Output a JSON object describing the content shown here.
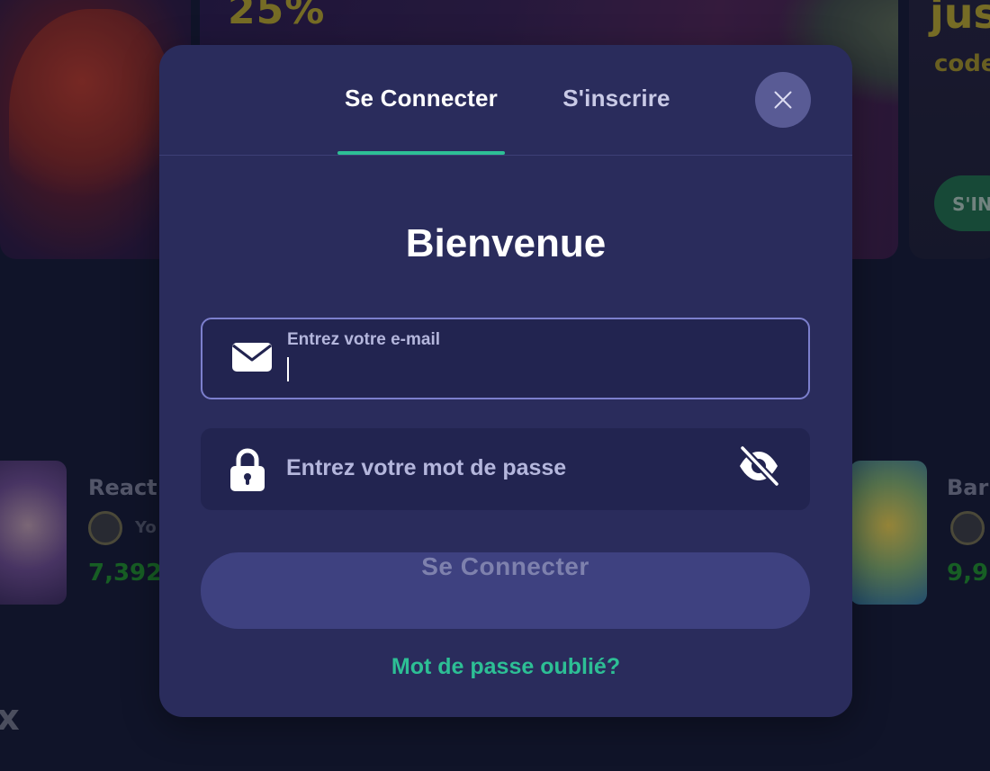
{
  "background": {
    "promo_percent": "25%",
    "promo_right_title": "jus",
    "promo_right_code": "code",
    "promo_right_cta": "S'IN",
    "games": [
      {
        "title": "React",
        "provider": "Yo",
        "amount": "7,392"
      },
      {
        "title": "Bar",
        "provider": "",
        "amount": "9,9"
      }
    ],
    "bottom_glyph": "x"
  },
  "modal": {
    "tabs": [
      {
        "label": "Se Connecter",
        "active": true
      },
      {
        "label": "S'inscrire",
        "active": false
      }
    ],
    "close_icon": "close-icon",
    "title": "Bienvenue",
    "email": {
      "label": "Entrez votre e-mail",
      "value": "",
      "icon": "envelope-icon"
    },
    "password": {
      "placeholder": "Entrez votre mot de passe",
      "value": "",
      "icon": "lock-icon",
      "visibility_icon": "eye-slash-icon"
    },
    "submit_label": "Se Connecter",
    "forgot_link": "Mot de passe oublié?",
    "colors": {
      "modal_bg": "#2a2c5c",
      "accent": "#2dbf95",
      "input_bg": "#222450",
      "button_bg": "#3e4180"
    }
  }
}
